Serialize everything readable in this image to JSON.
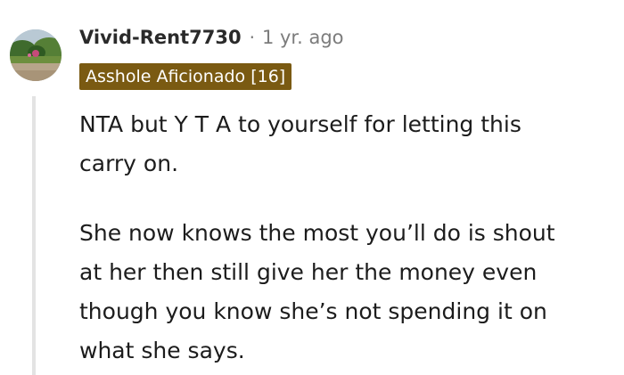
{
  "comment": {
    "username": "Vivid-Rent7730",
    "separator": "·",
    "timestamp": "1 yr. ago",
    "flair": "Asshole Aficionado [16]",
    "colors": {
      "flair_background": "#7a5a12",
      "flair_text": "#ffffff",
      "muted_text": "#7c7c7c",
      "thread_line": "#e3e3e3"
    },
    "avatar_icon": "user-avatar-photo",
    "body": {
      "paragraph_1": {
        "line_1": "NTA but Y T A to yourself for letting this",
        "line_2": "carry on."
      },
      "paragraph_2": {
        "line_1": "She now knows the most you’ll do is shout",
        "line_2": "at her then still give her the money even",
        "line_3": "though you know she’s not spending it on",
        "line_4": "what she says."
      }
    }
  }
}
